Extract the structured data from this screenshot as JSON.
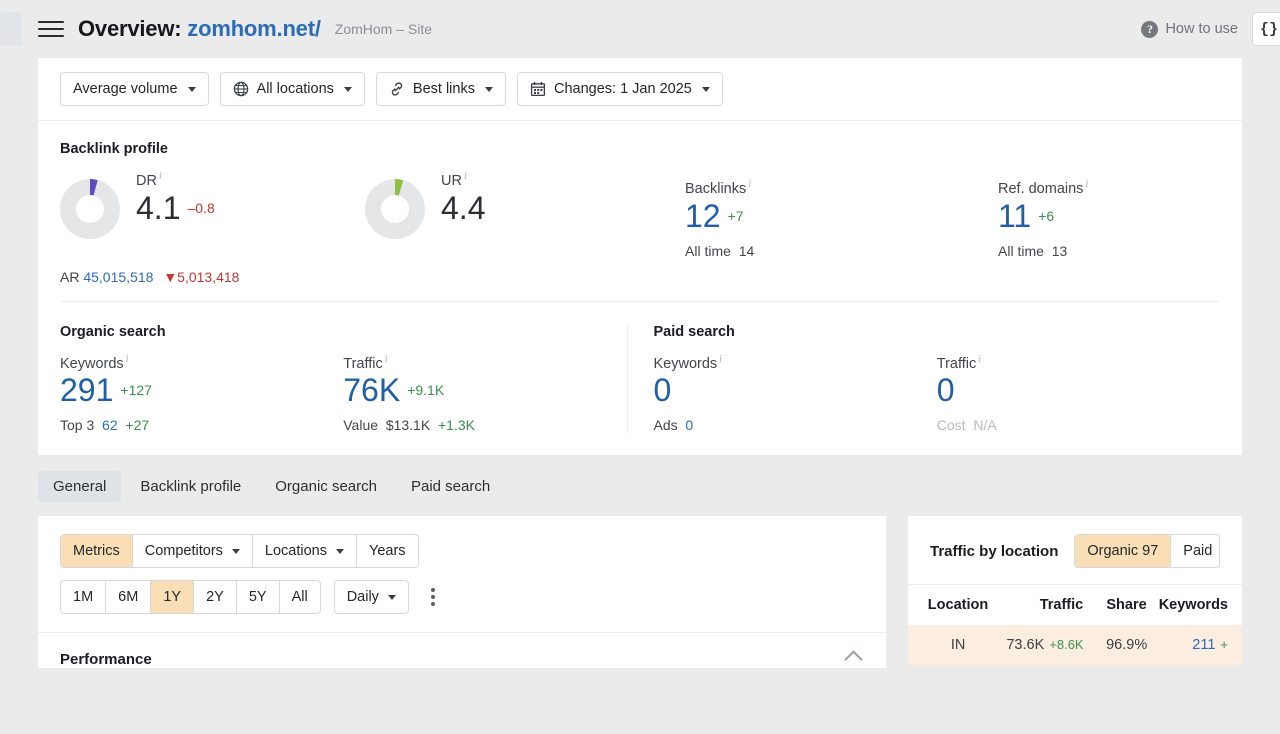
{
  "header": {
    "menu_icon": "hamburger-icon",
    "title_prefix": "Overview:",
    "domain": "zomhom.net/",
    "site_subtitle": "ZomHom – Site",
    "how_to_use": "How to use",
    "help_icon": "question-mark-icon",
    "code_button": "{}"
  },
  "filters": [
    {
      "label": "Average volume",
      "icon": "none",
      "caret": true
    },
    {
      "label": "All locations",
      "icon": "globe-icon",
      "caret": true
    },
    {
      "label": "Best links",
      "icon": "link-icon",
      "caret": true
    },
    {
      "label": "Changes: 1 Jan 2025",
      "icon": "calendar-icon",
      "caret": true
    }
  ],
  "backlink_profile": {
    "title": "Backlink profile",
    "dr": {
      "label": "DR",
      "value": "4.1",
      "delta": "–0.8",
      "delta_dir": "down",
      "arc_color": "#5b4cc4",
      "arc_percent": 4.1
    },
    "ur": {
      "label": "UR",
      "value": "4.4",
      "delta": "",
      "arc_color": "#8cbf3f",
      "arc_percent": 4.4
    },
    "ar": {
      "label": "AR",
      "value": "45,015,518",
      "delta": "5,013,418",
      "delta_dir": "down"
    },
    "backlinks": {
      "label": "Backlinks",
      "value": "12",
      "delta": "+7",
      "sub_label": "All time",
      "sub_value": "14"
    },
    "ref_domains": {
      "label": "Ref. domains",
      "value": "11",
      "delta": "+6",
      "sub_label": "All time",
      "sub_value": "13"
    }
  },
  "organic_search": {
    "title": "Organic search",
    "keywords": {
      "label": "Keywords",
      "value": "291",
      "delta": "+127",
      "sub_label": "Top 3",
      "sub_value": "62",
      "sub_delta": "+27"
    },
    "traffic": {
      "label": "Traffic",
      "value": "76K",
      "delta": "+9.1K",
      "sub_label": "Value",
      "sub_value": "$13.1K",
      "sub_delta": "+1.3K"
    }
  },
  "paid_search": {
    "title": "Paid search",
    "keywords": {
      "label": "Keywords",
      "value": "0",
      "delta": "",
      "sub_label": "Ads",
      "sub_value": "0"
    },
    "traffic": {
      "label": "Traffic",
      "value": "0",
      "delta": "",
      "sub_label": "Cost",
      "sub_value": "N/A"
    }
  },
  "tabs": [
    {
      "label": "General",
      "active": true
    },
    {
      "label": "Backlink profile",
      "active": false
    },
    {
      "label": "Organic search",
      "active": false
    },
    {
      "label": "Paid search",
      "active": false
    }
  ],
  "chart_panel": {
    "view_segments": [
      {
        "label": "Metrics",
        "selected": true,
        "caret": false
      },
      {
        "label": "Competitors",
        "selected": false,
        "caret": true
      },
      {
        "label": "Locations",
        "selected": false,
        "caret": true
      },
      {
        "label": "Years",
        "selected": false,
        "caret": false
      }
    ],
    "ranges": [
      {
        "label": "1M",
        "selected": false
      },
      {
        "label": "6M",
        "selected": false
      },
      {
        "label": "1Y",
        "selected": true
      },
      {
        "label": "2Y",
        "selected": false
      },
      {
        "label": "5Y",
        "selected": false
      },
      {
        "label": "All",
        "selected": false
      }
    ],
    "granularity": {
      "label": "Daily",
      "caret": true
    },
    "more_icon": "kebab-menu-icon",
    "performance_title": "Performance",
    "collapse_icon": "chevron-up-icon"
  },
  "traffic_by_location": {
    "title": "Traffic by location",
    "toggles": [
      {
        "label": "Organic 97",
        "selected": true
      },
      {
        "label": "Paid",
        "selected": false
      }
    ],
    "columns": [
      "Location",
      "Traffic",
      "Share",
      "Keywords"
    ],
    "rows": [
      {
        "location": "IN",
        "traffic": "73.6K",
        "traffic_delta": "+8.6K",
        "share": "96.9%",
        "keywords": "211",
        "keywords_delta": "+"
      }
    ]
  },
  "colors": {
    "accent_blue": "#2b6cb8",
    "up_green": "#3c8f4e",
    "down_red": "#c23934",
    "highlight_orange": "#fadfb6",
    "row_highlight": "#fbeee0"
  }
}
